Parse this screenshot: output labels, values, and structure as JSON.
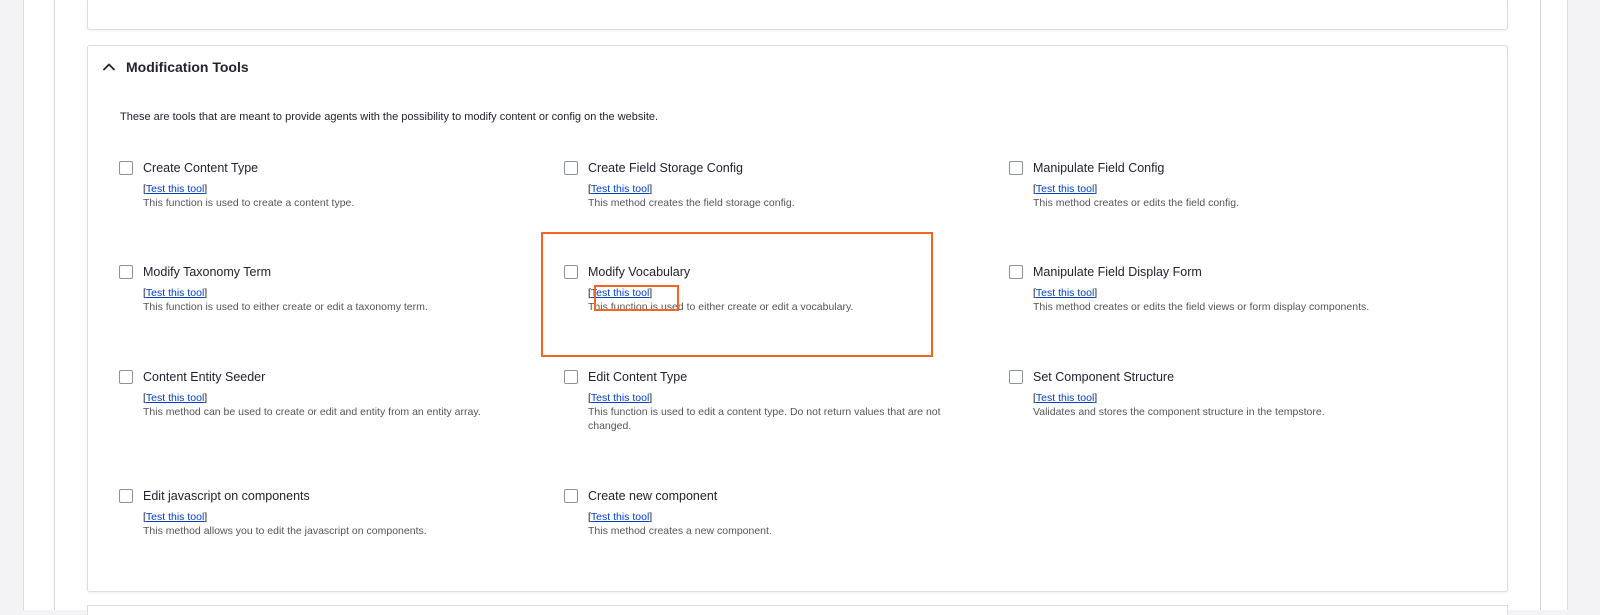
{
  "panel": {
    "title": "Modification Tools",
    "expanded": true,
    "description": "These are tools that are meant to provide agents with the possibility to modify content or config on the website."
  },
  "link_label": "Test this tool",
  "tools": [
    {
      "name": "Create Content Type",
      "checked": false,
      "description": "This function is used to create a content type."
    },
    {
      "name": "Create Field Storage Config",
      "checked": false,
      "description": "This method creates the field storage config."
    },
    {
      "name": "Manipulate Field Config",
      "checked": false,
      "description": "This method creates or edits the field config."
    },
    {
      "name": "Modify Taxonomy Term",
      "checked": false,
      "description": "This function is used to either create or edit a taxonomy term."
    },
    {
      "name": "Modify Vocabulary",
      "checked": false,
      "description": "This function is used to either create or edit a vocabulary."
    },
    {
      "name": "Manipulate Field Display Form",
      "checked": false,
      "description": "This method creates or edits the field views or form display components."
    },
    {
      "name": "Content Entity Seeder",
      "checked": false,
      "description": "This method can be used to create or edit and entity from an entity array."
    },
    {
      "name": "Edit Content Type",
      "checked": false,
      "description": "This function is used to edit a content type. Do not return values that are not changed."
    },
    {
      "name": "Set Component Structure",
      "checked": false,
      "description": "Validates and stores the component structure in the tempstore."
    },
    {
      "name": "Edit javascript on components",
      "checked": false,
      "description": "This method allows you to edit the javascript on components."
    },
    {
      "name": "Create new component",
      "checked": false,
      "description": "This method creates a new component."
    }
  ],
  "colors": {
    "link": "#003ecc",
    "highlight": "#f26522",
    "border": "#dcdce1"
  },
  "icons": {
    "panel_toggle": "chevron-up-icon"
  }
}
